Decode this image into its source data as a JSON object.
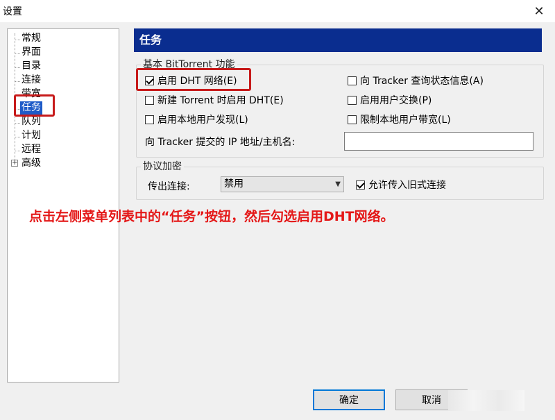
{
  "window": {
    "title": "设置",
    "close_glyph": "✕"
  },
  "tree": {
    "items": [
      {
        "label": "常规"
      },
      {
        "label": "界面"
      },
      {
        "label": "目录"
      },
      {
        "label": "连接"
      },
      {
        "label": "带宽"
      },
      {
        "label": "任务",
        "selected": true
      },
      {
        "label": "队列"
      },
      {
        "label": "计划"
      },
      {
        "label": "远程"
      },
      {
        "label": "高级",
        "expandable": true
      }
    ],
    "expander_glyph": "+"
  },
  "header": {
    "title": "任务"
  },
  "bittorrent_group": {
    "label": "基本 BitTorrent 功能",
    "options": {
      "enable_dht": {
        "label": "启用 DHT 网络(E)",
        "checked": true
      },
      "query_tracker": {
        "label": "向 Tracker 查询状态信息(A)",
        "checked": false
      },
      "new_torrent_dht": {
        "label": "新建 Torrent 时启用 DHT(E)",
        "checked": false
      },
      "peer_exchange": {
        "label": "启用用户交换(P)",
        "checked": false
      },
      "local_discovery": {
        "label": "启用本地用户发现(L)",
        "checked": false
      },
      "limit_local_bw": {
        "label": "限制本地用户带宽(L)",
        "checked": false
      }
    },
    "tracker_ip_label": "向 Tracker 提交的 IP 地址/主机名:",
    "tracker_ip_value": ""
  },
  "encryption_group": {
    "label": "协议加密",
    "outgoing_label": "传出连接:",
    "outgoing_value": "禁用",
    "allow_legacy": {
      "label": "允许传入旧式连接",
      "checked": true
    }
  },
  "annotation": {
    "text": "点击左侧菜单列表中的“任务”按钮，然后勾选启用DHT网络。"
  },
  "footer": {
    "ok_label": "确定",
    "cancel_label": "取消"
  },
  "colors": {
    "header_bg": "#0a2d8f",
    "selection_bg": "#1e5bc8",
    "annotation_red": "#e41818",
    "highlight_box": "#c71a1a"
  }
}
